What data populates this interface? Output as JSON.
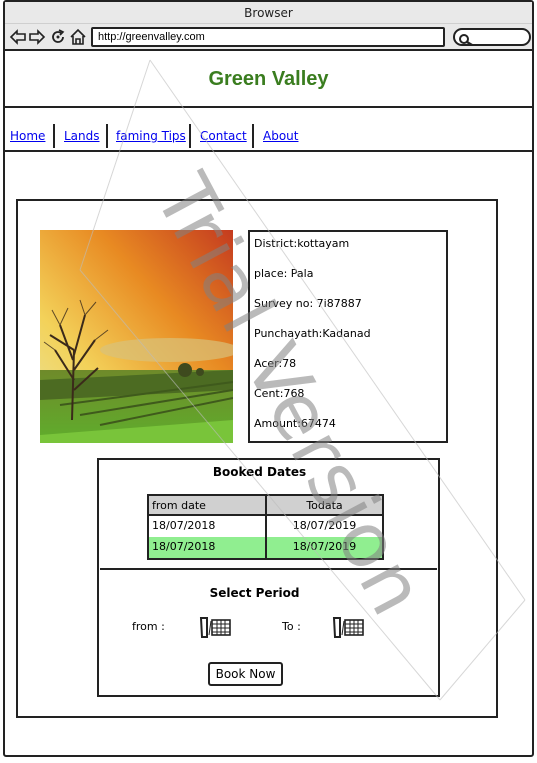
{
  "browser": {
    "title": "Browser",
    "url": "http://greenvalley.com",
    "icons": [
      "back-arrow-icon",
      "forward-arrow-icon",
      "reload-icon",
      "home-icon",
      "search-icon"
    ]
  },
  "site": {
    "title": "Green Valley",
    "title_color": "#3a7d1f"
  },
  "nav": {
    "items": [
      {
        "label": "Home"
      },
      {
        "label": "Lands"
      },
      {
        "label": "faming Tips"
      },
      {
        "label": "Contact"
      },
      {
        "label": "About"
      }
    ]
  },
  "property": {
    "lines": [
      "District:kottayam",
      "place: Pala",
      "Survey no: 7i87887",
      "Punchayath:Kadanad",
      "Acer:78",
      "Cent:768",
      "Amount:67474"
    ]
  },
  "booked": {
    "title": "Booked Dates",
    "headers": [
      "from date",
      "Todata"
    ],
    "rows": [
      {
        "from": "18/07/2018",
        "to": "18/07/2019",
        "highlight": false
      },
      {
        "from": "18/07/2018",
        "to": "18/07/2019",
        "highlight": true
      }
    ],
    "highlight_color": "#90ee90",
    "header_color": "#d0d0d0"
  },
  "period": {
    "title": "Select Period",
    "from_label": "from :",
    "to_label": "To :",
    "book_label": "Book Now"
  },
  "watermark": "Trial Version"
}
